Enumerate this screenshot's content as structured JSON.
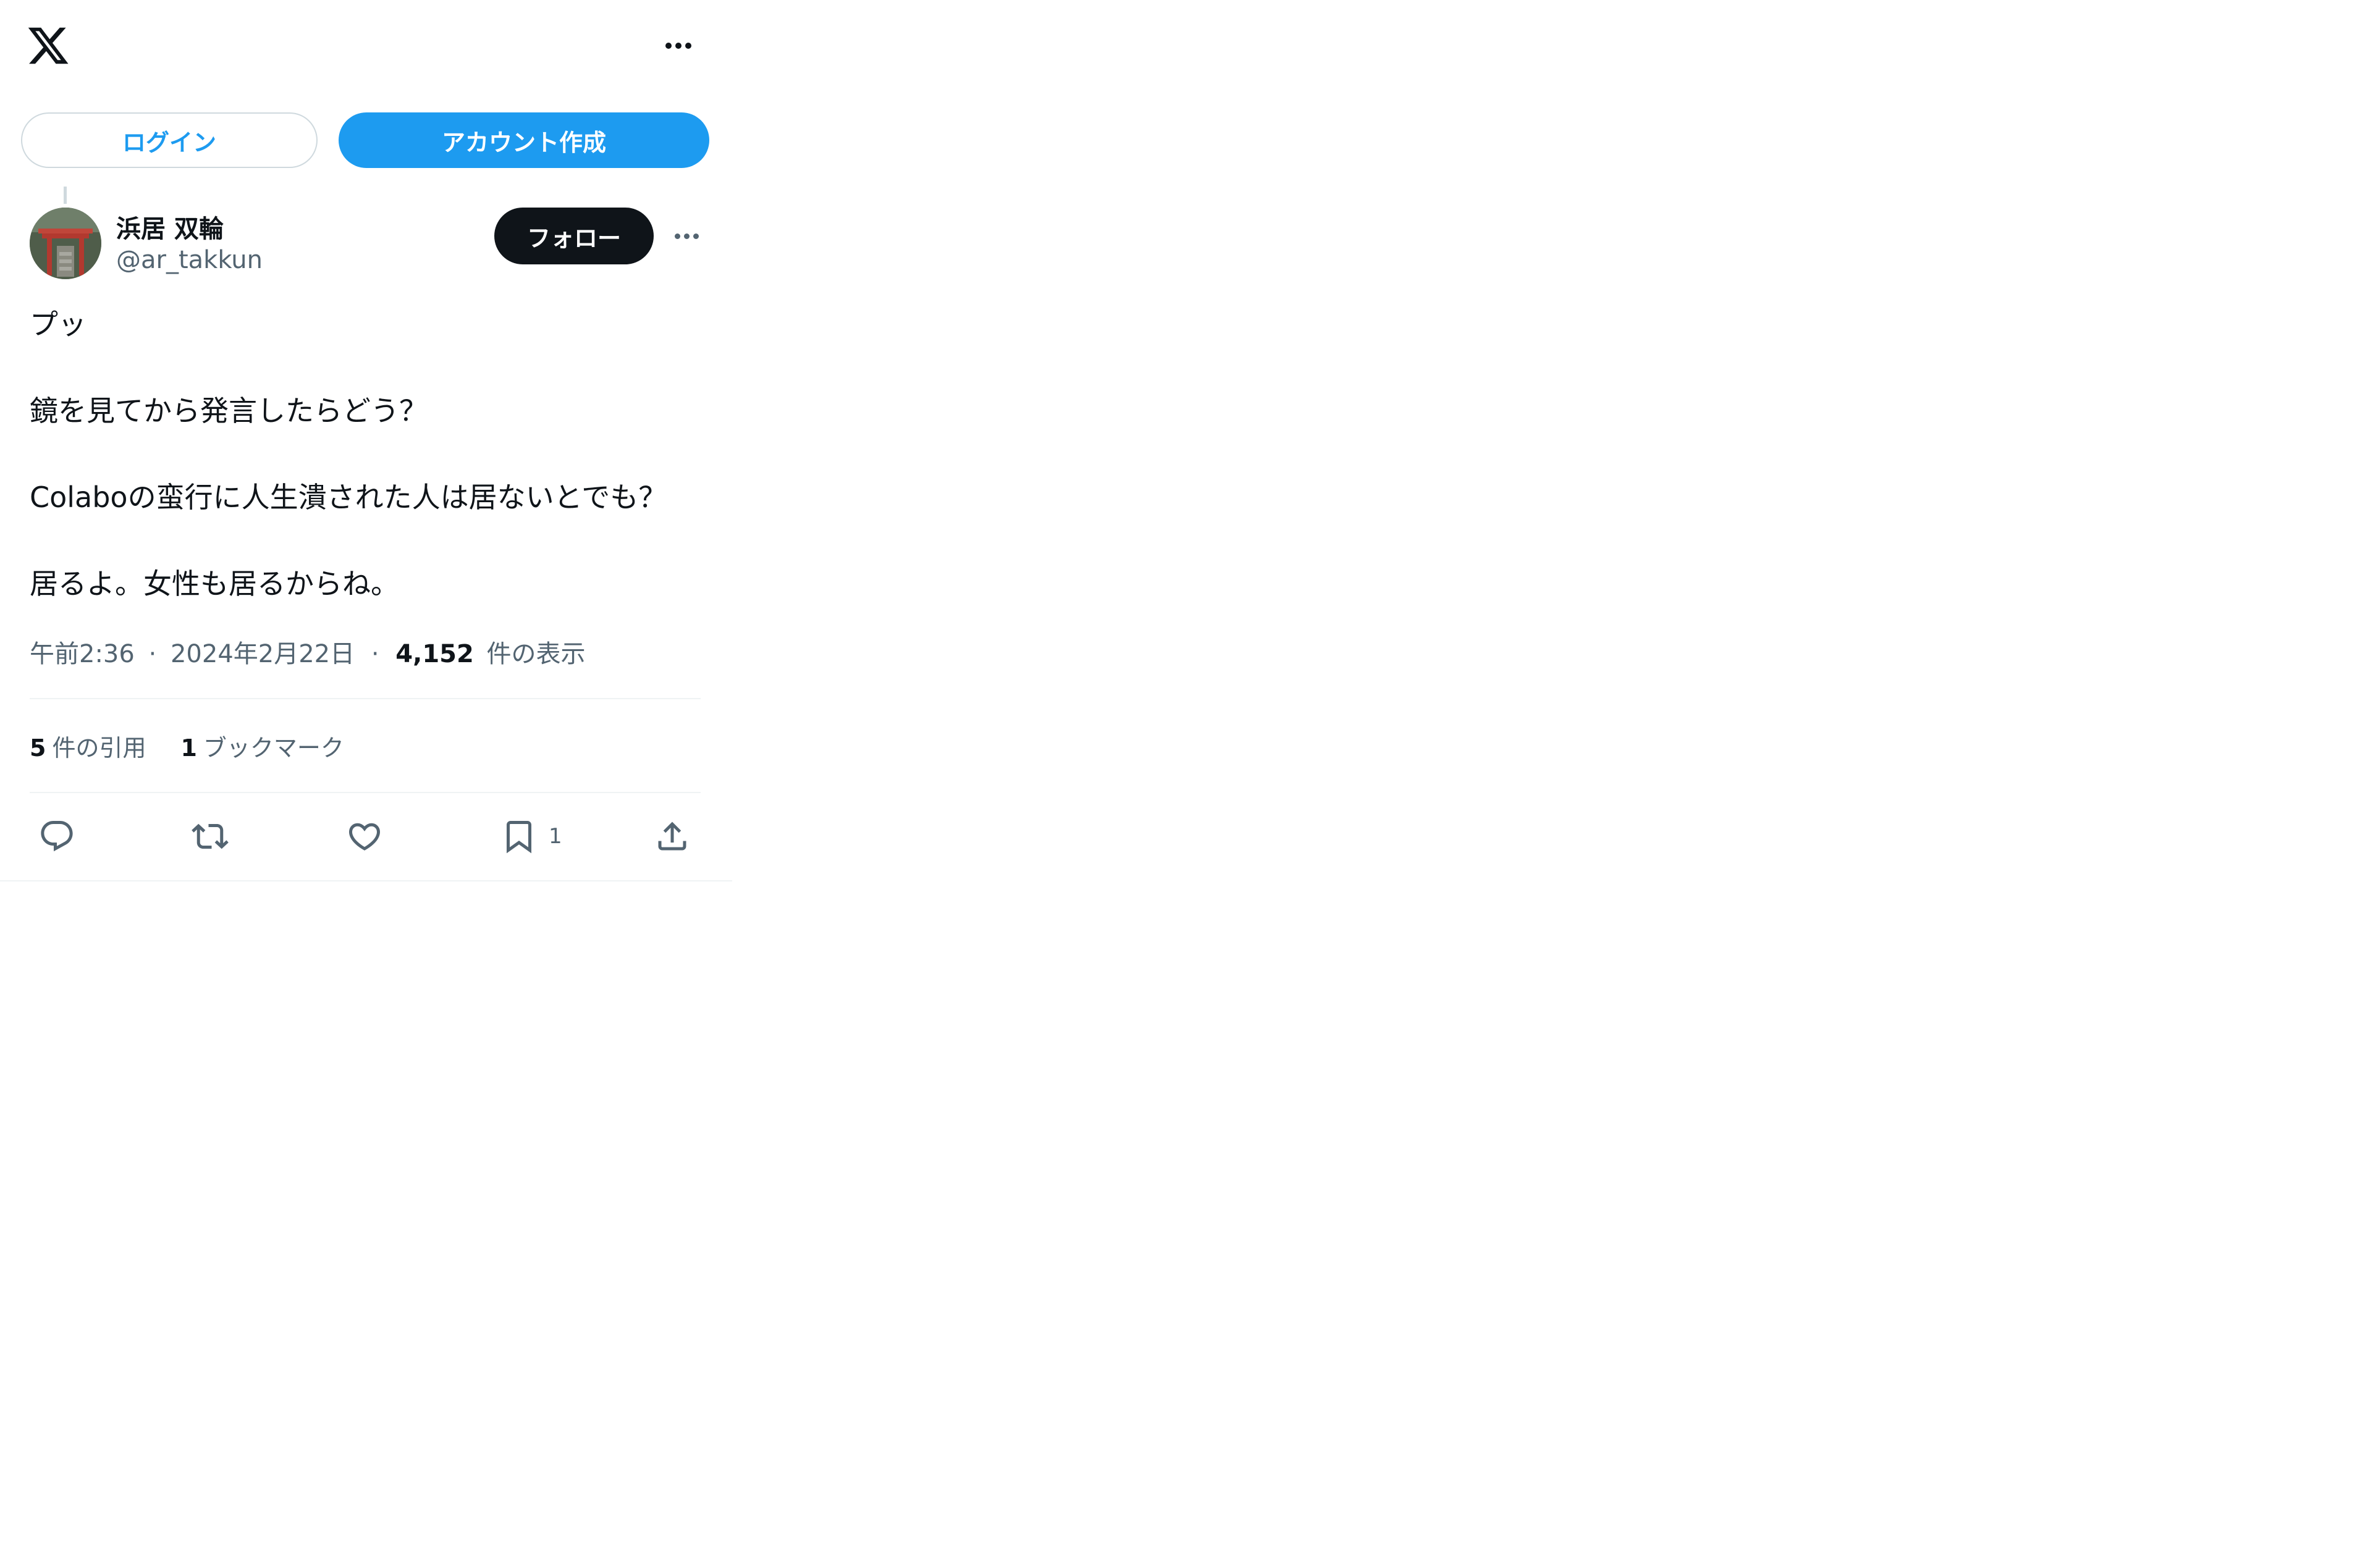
{
  "header": {
    "logo_icon": "x-logo-icon",
    "more_icon": "more-horizontal-icon"
  },
  "auth": {
    "login_label": "ログイン",
    "signup_label": "アカウント作成"
  },
  "tweet": {
    "author": {
      "display_name": "浜居 双輪",
      "handle": "@ar_takkun",
      "avatar_icon": "avatar-image"
    },
    "follow_label": "フォロー",
    "paragraphs": [
      "プッ",
      "鏡を見てから発言したらどう？",
      "Colaboの蛮行に人生潰された人は居ないとでも？",
      "居るよ。女性も居るからね。"
    ],
    "meta": {
      "time": "午前2:36",
      "separator": "·",
      "date": "2024年2月22日",
      "views_count": "4,152",
      "views_label": "件の表示"
    },
    "stats": {
      "quotes_count": "5",
      "quotes_label": "件の引用",
      "bookmarks_count": "1",
      "bookmarks_label": "ブックマーク"
    },
    "actions": {
      "reply_icon": "reply-icon",
      "retweet_icon": "retweet-icon",
      "like_icon": "like-icon",
      "bookmark_icon": "bookmark-icon",
      "bookmark_count": "1",
      "share_icon": "share-icon"
    }
  },
  "colors": {
    "brand_blue": "#1d9bf0",
    "text_primary": "#0f1419",
    "text_secondary": "#536471",
    "border": "#cfd9de",
    "divider": "#eff3f4"
  }
}
